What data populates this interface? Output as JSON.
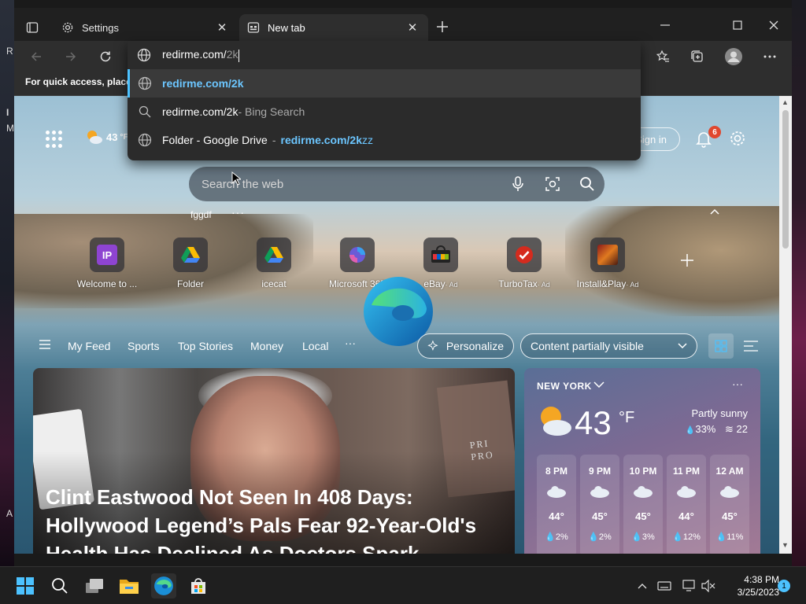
{
  "desktop": {
    "left_labels": [
      "R",
      "I",
      "M",
      "A"
    ]
  },
  "browser": {
    "tabs": [
      {
        "title": "Settings",
        "icon": "gear-icon",
        "active": false
      },
      {
        "title": "New tab",
        "icon": "newtab-page-icon",
        "active": true
      }
    ],
    "favorites_bar_text": "For quick access, place y",
    "address": {
      "typed": "redirme.com/",
      "autocomplete": "2k"
    },
    "suggestions": [
      {
        "icon": "globe-icon",
        "main": "redirme.com/2k",
        "suffix": "",
        "selected": true
      },
      {
        "icon": "search-icon",
        "main": "redirme.com/2k",
        "suffix": " - Bing Search",
        "selected": false
      },
      {
        "icon": "globe-icon",
        "main": "Folder - Google Drive",
        "suffix_blue": "redirme.com/2k",
        "suffix_dim": "zz",
        "selected": false
      }
    ]
  },
  "newtab": {
    "weather_mini": "43",
    "weather_mini_unit": "°F",
    "signin_label": "Sign in",
    "notification_count": "6",
    "search_placeholder": "Search the web",
    "quick_label": "fggdf",
    "quick_more": "···",
    "tiles": [
      {
        "label": "Welcome to ...",
        "icon": "ip-icon",
        "ad": ""
      },
      {
        "label": "Folder",
        "icon": "google-drive-icon",
        "ad": ""
      },
      {
        "label": "icecat",
        "icon": "google-drive-icon",
        "ad": ""
      },
      {
        "label": "Microsoft 365",
        "icon": "microsoft365-icon",
        "ad": ""
      },
      {
        "label": "eBay",
        "icon": "ebay-icon",
        "ad": "· Ad"
      },
      {
        "label": "TurboTax",
        "icon": "turbotax-icon",
        "ad": "· Ad"
      },
      {
        "label": "Install&Play",
        "icon": "game-icon",
        "ad": "· Ad"
      }
    ],
    "feed_tabs": [
      "My Feed",
      "Sports",
      "Top Stories",
      "Money",
      "Local"
    ],
    "feed_more": "···",
    "personalize_label": "Personalize",
    "content_visibility": "Content partially visible",
    "hero": {
      "sign_text": "PRI PRO",
      "headline": "Clint Eastwood Not Seen In 408 Days: Hollywood Legend’s Pals Fear 92-Year-Old's Health Has Declined As Doctors Spark..."
    },
    "weather": {
      "city": "NEW YORK",
      "temp": "43",
      "unit": "°F",
      "condition": "Partly sunny",
      "humidity": "33%",
      "wind": "22",
      "hours": [
        {
          "time": "8 PM",
          "temp": "44°",
          "precip": "2%"
        },
        {
          "time": "9 PM",
          "temp": "45°",
          "precip": "2%"
        },
        {
          "time": "10 PM",
          "temp": "45°",
          "precip": "3%"
        },
        {
          "time": "11 PM",
          "temp": "44°",
          "precip": "12%"
        },
        {
          "time": "12 AM",
          "temp": "45°",
          "precip": "11%"
        }
      ]
    }
  },
  "taskbar": {
    "time": "4:38 PM",
    "date": "3/25/2023",
    "notification_count": "1"
  },
  "colors": {
    "accent": "#4cc2ff",
    "suggestion_blue": "#6cc6ff",
    "badge_red": "#e0472e"
  }
}
